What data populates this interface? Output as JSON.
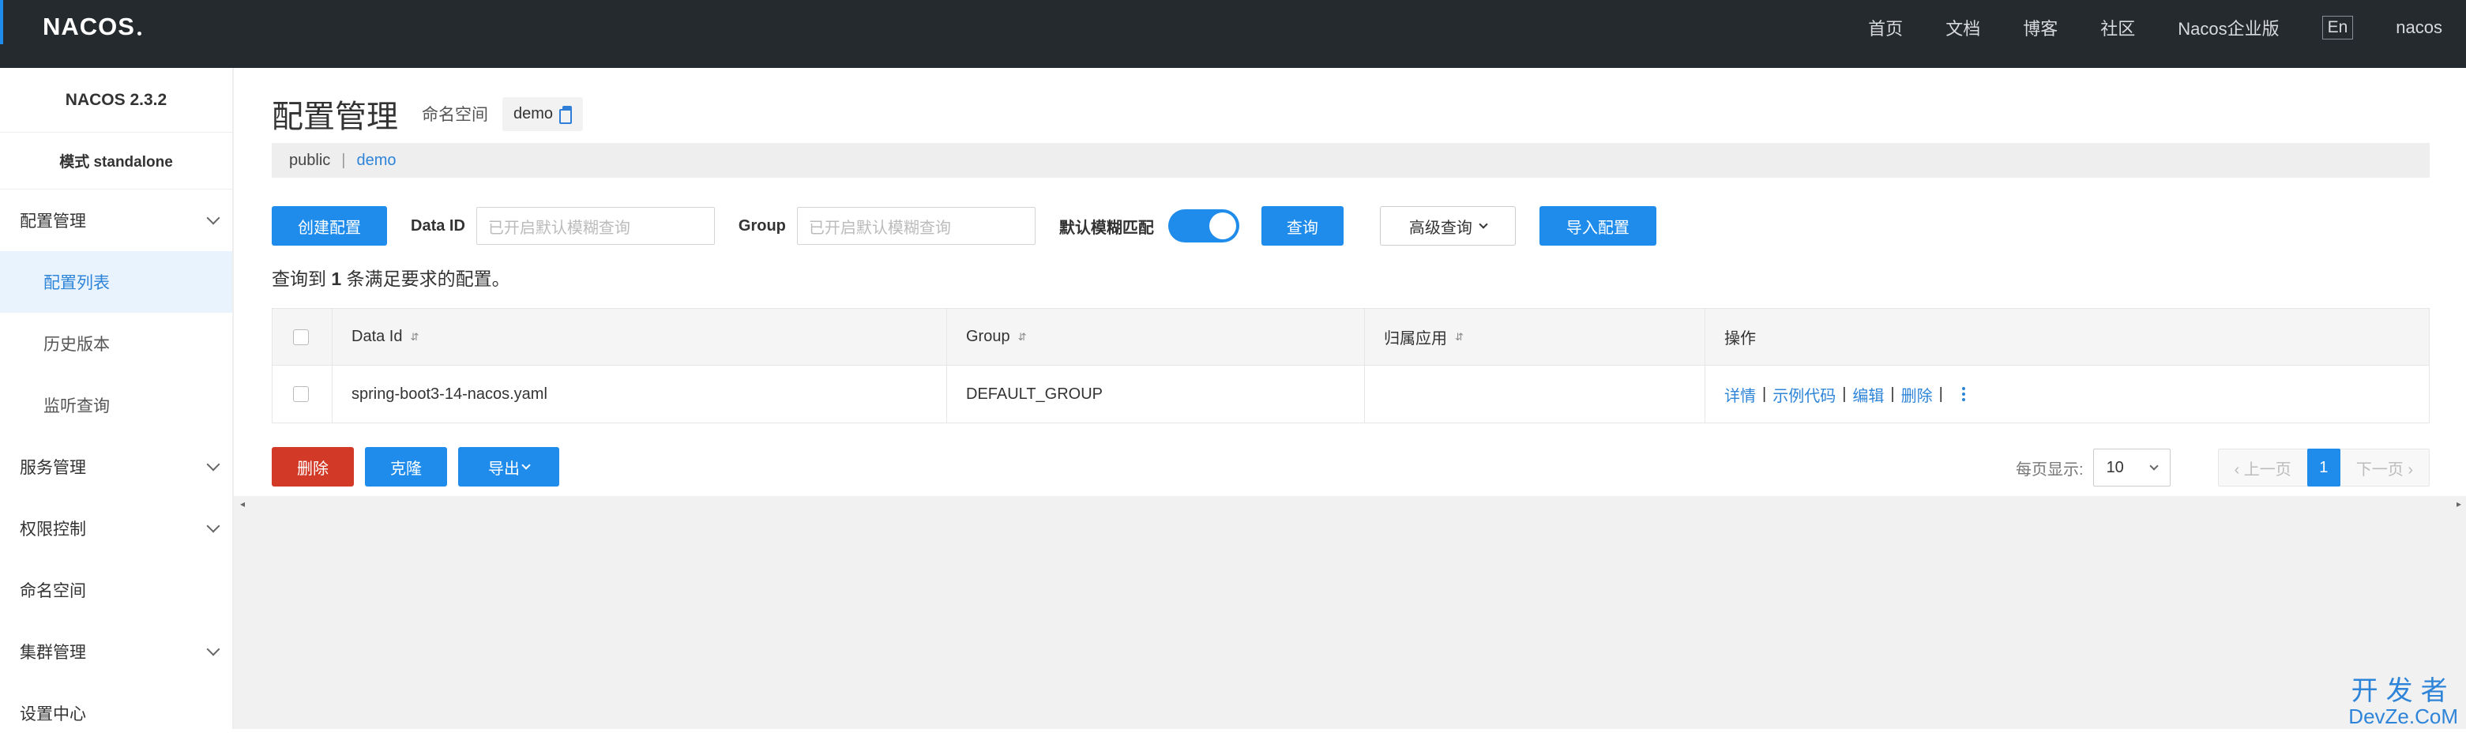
{
  "header": {
    "logo": "NACOS",
    "nav": [
      "首页",
      "文档",
      "博客",
      "社区",
      "Nacos企业版"
    ],
    "lang": "En",
    "user": "nacos"
  },
  "sidebar": {
    "version": "NACOS 2.3.2",
    "mode": "模式 standalone",
    "items": [
      {
        "label": "配置管理",
        "expandable": true
      },
      {
        "label": "配置列表",
        "active": true
      },
      {
        "label": "历史版本"
      },
      {
        "label": "监听查询"
      },
      {
        "label": "服务管理",
        "expandable": true
      },
      {
        "label": "权限控制",
        "expandable": true
      },
      {
        "label": "命名空间"
      },
      {
        "label": "集群管理",
        "expandable": true
      },
      {
        "label": "设置中心"
      }
    ]
  },
  "main": {
    "title": "配置管理",
    "namespace_label": "命名空间",
    "namespace_value": "demo",
    "ns_bar": {
      "public": "public",
      "sep": "|",
      "demo": "demo"
    },
    "search": {
      "create_button": "创建配置",
      "dataid_label": "Data ID",
      "dataid_placeholder": "已开启默认模糊查询",
      "group_label": "Group",
      "group_placeholder": "已开启默认模糊查询",
      "fuzzy_label": "默认模糊匹配",
      "fuzzy_on": true,
      "query_button": "查询",
      "advanced_button": "高级查询",
      "import_button": "导入配置"
    },
    "result": {
      "prefix": "查询到",
      "count": "1",
      "suffix": "条满足要求的配置。"
    },
    "table": {
      "headers": [
        "Data Id",
        "Group",
        "归属应用",
        "操作"
      ],
      "sort_icon": "⇵",
      "rows": [
        {
          "data_id": "spring-boot3-14-nacos.yaml",
          "group": "DEFAULT_GROUP",
          "app": "",
          "ops": [
            "详情",
            "示例代码",
            "编辑",
            "删除"
          ]
        }
      ]
    },
    "bottom": {
      "delete_button": "删除",
      "clone_button": "克隆",
      "export_button": "导出",
      "perpage_label": "每页显示:",
      "perpage_value": "10",
      "prev": "上一页",
      "current_page": "1",
      "next": "下一页"
    }
  },
  "watermark": {
    "line1": "开发者",
    "line2": "DevZe.CoM"
  },
  "colors": {
    "primary": "#1f8ceb",
    "danger": "#d23a27",
    "topbar": "#252a2f",
    "link": "#2e84d8"
  }
}
